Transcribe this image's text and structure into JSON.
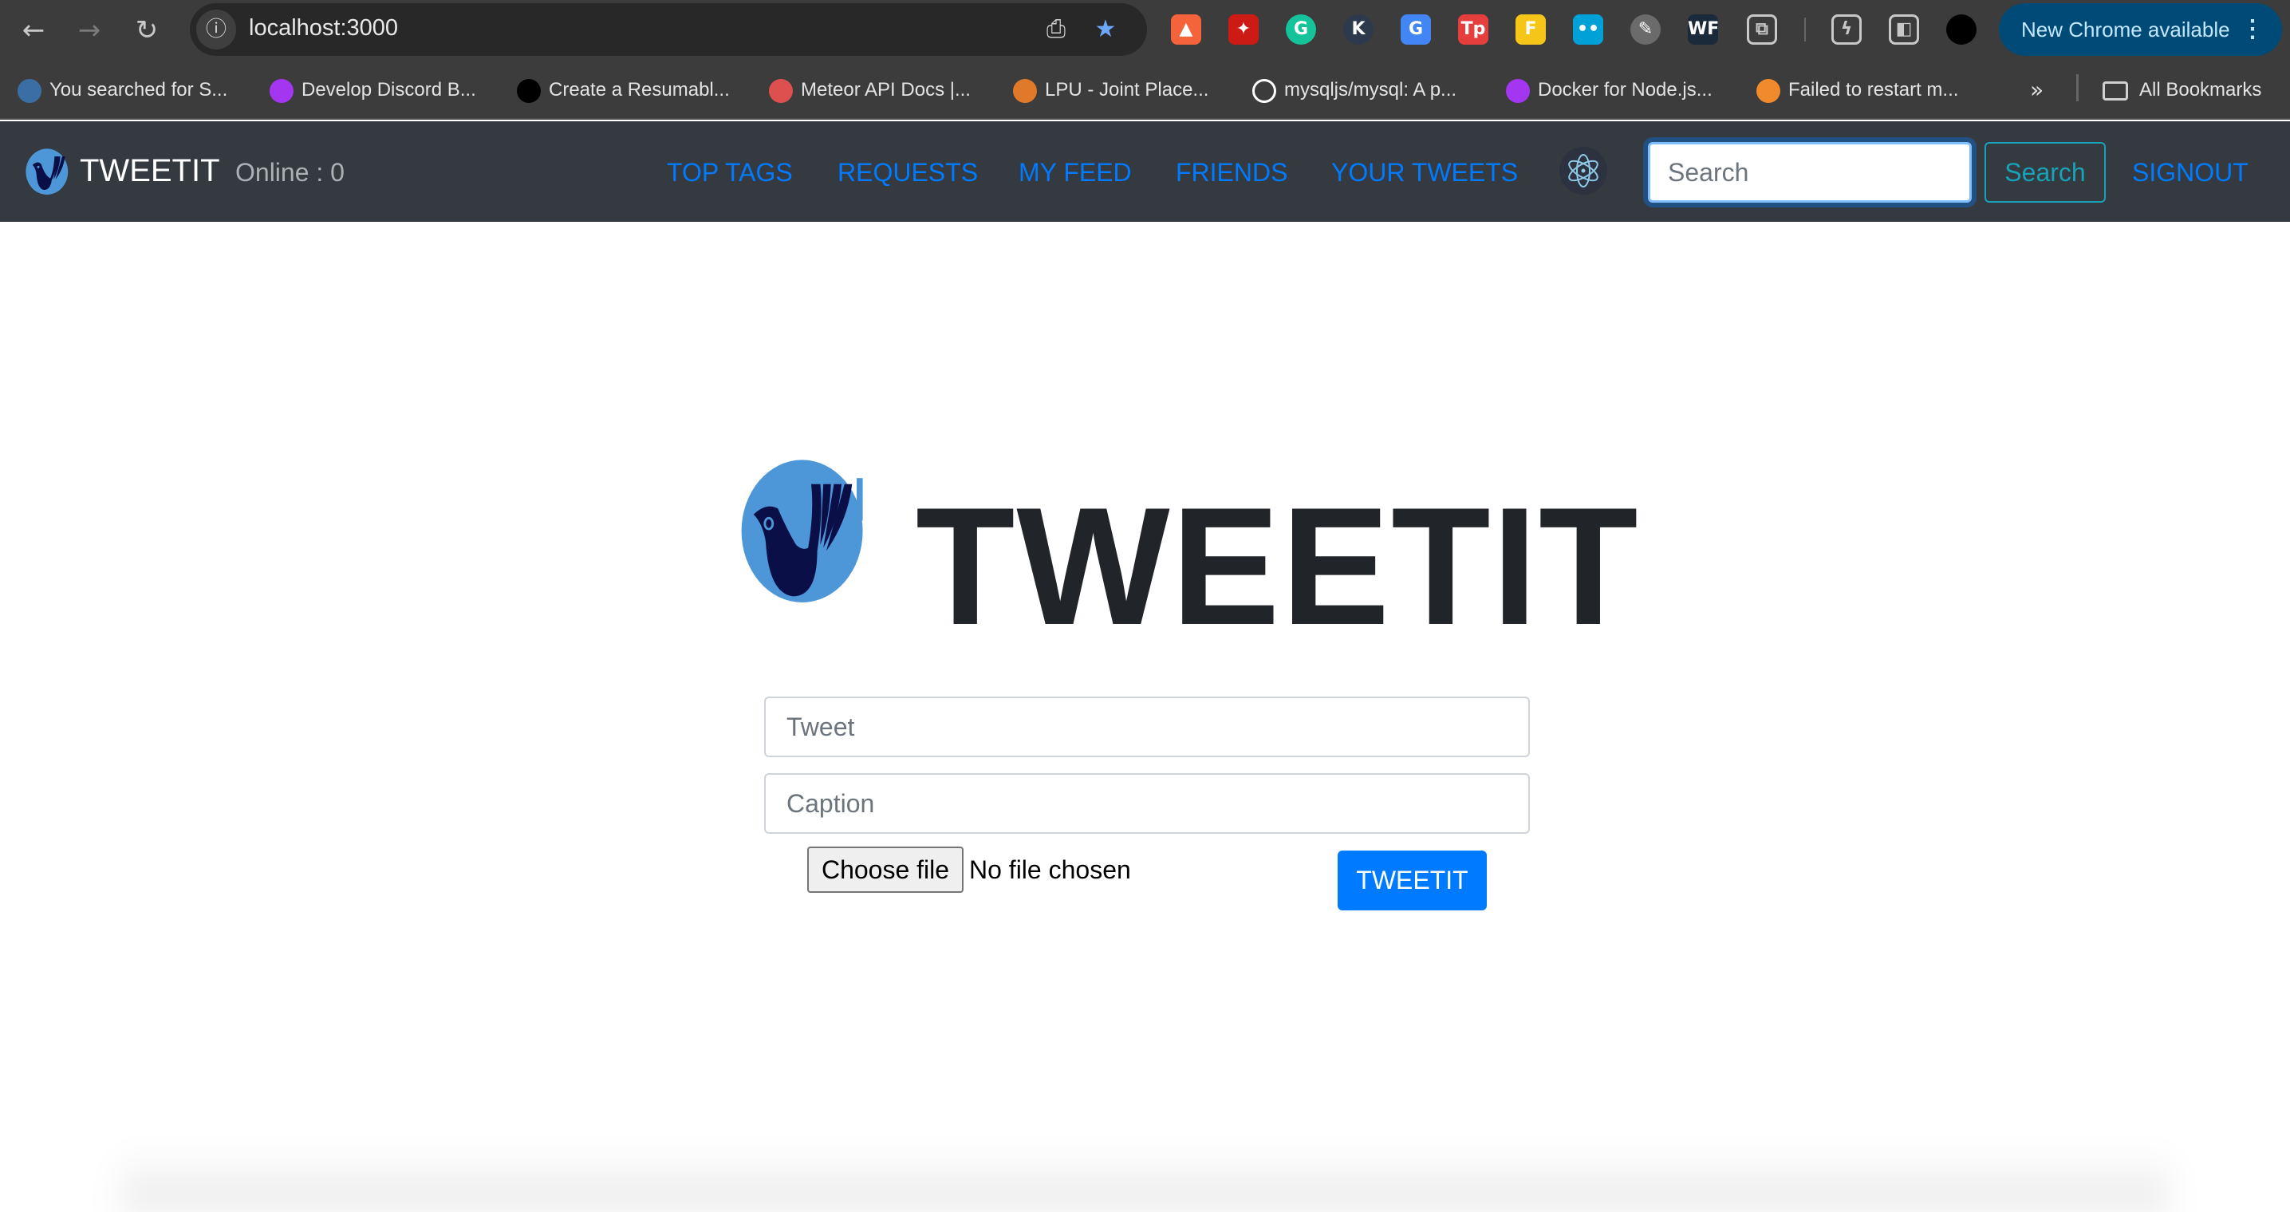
{
  "browser": {
    "url": "localhost:3000",
    "nav": {
      "back_icon": "back-arrow-icon",
      "forward_icon": "forward-arrow-icon",
      "reload_icon": "reload-icon"
    },
    "extensions": [
      {
        "name": "lighthouse-icon",
        "glyph": "▲",
        "color": "#f4633a"
      },
      {
        "name": "magic-wand-icon",
        "glyph": "✦",
        "color": "#cc1a14"
      },
      {
        "name": "grammarly-icon",
        "glyph": "G",
        "color": "#15c39a"
      },
      {
        "name": "k-extension-icon",
        "glyph": "K",
        "color": "#2d3a4d"
      },
      {
        "name": "google-translate-icon",
        "glyph": "G",
        "color": "#4285f4"
      },
      {
        "name": "tp-extension-icon",
        "glyph": "Tp",
        "color": "#e63d3d"
      },
      {
        "name": "f-extension-icon",
        "glyph": "F",
        "color": "#f5c518"
      },
      {
        "name": "bilibili-icon",
        "glyph": "••",
        "color": "#00a1d6"
      },
      {
        "name": "wrench-extension-icon",
        "glyph": "✎",
        "color": "#6b6b6b"
      },
      {
        "name": "wf-extension-icon",
        "glyph": "WF",
        "color": "#1b2a3a"
      },
      {
        "name": "extensions-puzzle-icon",
        "glyph": "⧉",
        "color": "#3c3c3c"
      },
      {
        "name": "performance-leaf-icon",
        "glyph": "ϟ",
        "color": "#3c3c3c"
      },
      {
        "name": "side-panel-icon",
        "glyph": "◧",
        "color": "#3c3c3c"
      },
      {
        "name": "profile-avatar",
        "glyph": "",
        "color": "#000000"
      }
    ],
    "update_label": "New Chrome available",
    "update_menu_icon": "kebab-menu-icon",
    "bookmarks": [
      {
        "label": "You searched for S...",
        "icon": "triangle-favicon",
        "color": "#3b6ea5"
      },
      {
        "label": "Develop Discord B...",
        "icon": "udemy-favicon",
        "color": "#a435f0"
      },
      {
        "label": "Create a Resumabl...",
        "icon": "medium-favicon",
        "color": "#000000"
      },
      {
        "label": "Meteor API Docs |...",
        "icon": "meteor-favicon",
        "color": "#de4f4f"
      },
      {
        "label": "LPU - Joint Place...",
        "icon": "lpu-favicon",
        "color": "#e07a2a"
      },
      {
        "label": "mysqljs/mysql: A p...",
        "icon": "github-favicon",
        "color": "#ffffff"
      },
      {
        "label": "Docker for Node.js...",
        "icon": "udemy-favicon",
        "color": "#a435f0"
      },
      {
        "label": "Failed to restart m...",
        "icon": "avatar-favicon",
        "color": "#f08a2c"
      }
    ],
    "more_bookmarks_icon": "chevron-double-right-icon",
    "all_bookmarks_label": "All Bookmarks"
  },
  "navbar": {
    "brand": "TWEETIT",
    "online_label": "Online : 0",
    "links": [
      "TOP TAGS",
      "REQUESTS",
      "MY FEED",
      "FRIENDS",
      "YOUR TWEETS"
    ],
    "search_placeholder": "Search",
    "search_button": "Search",
    "signout": "SIGNOUT"
  },
  "main": {
    "title": "TWEETIT",
    "tweet_placeholder": "Tweet",
    "caption_placeholder": "Caption",
    "choose_file_label": "Choose file",
    "file_status": "No file chosen",
    "submit_label": "TWEETIT"
  },
  "colors": {
    "navbar_bg": "#343a40",
    "link": "#007bff",
    "outline_info": "#17a2b8",
    "primary": "#007bff",
    "logo_light": "#4d97d9",
    "logo_dark": "#0b0f47"
  }
}
